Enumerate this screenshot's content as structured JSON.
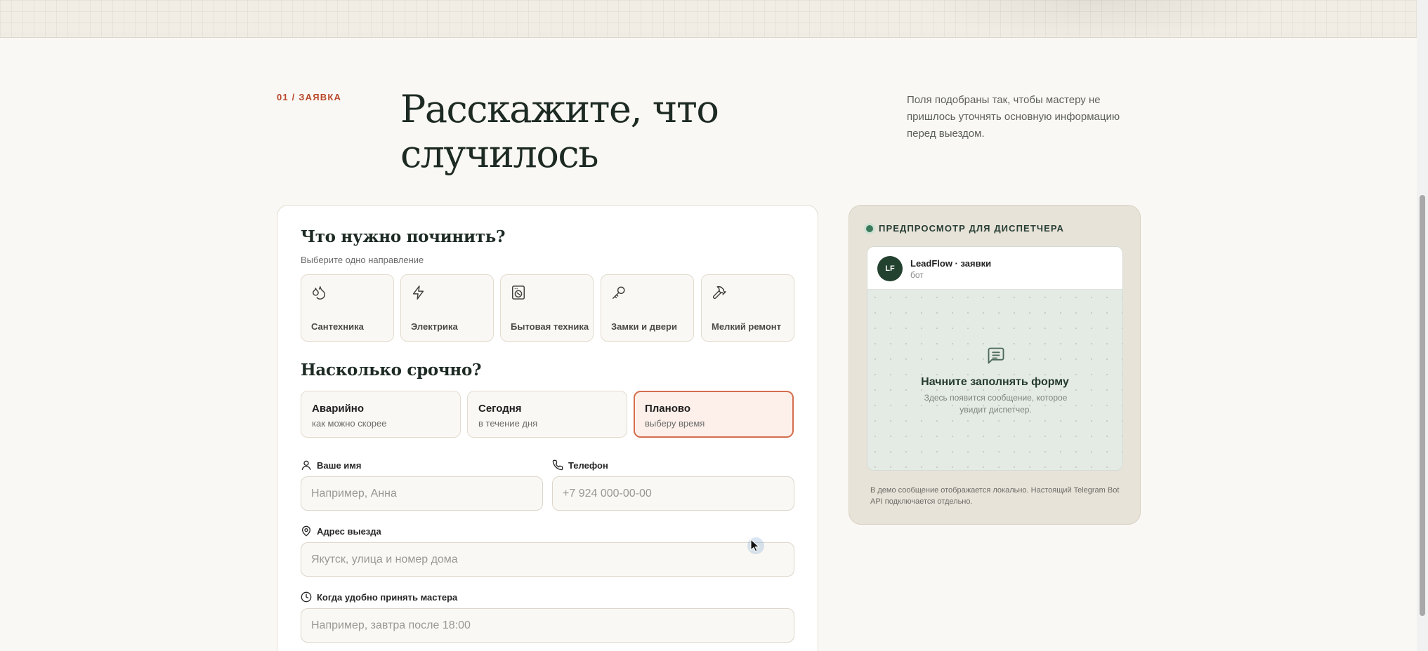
{
  "hero": {
    "eyebrow": "01 / ЗАЯВКА",
    "title_line1": "Расскажите, что",
    "title_line2": "случилось",
    "note": "Поля подобраны так, чтобы мастеру не пришлось уточнять основную информацию перед выездом."
  },
  "form": {
    "category_title": "Что нужно починить?",
    "category_subtitle": "Выберите одно направление",
    "categories": [
      {
        "label": "Сантехника",
        "icon": "droplets-icon"
      },
      {
        "label": "Электрика",
        "icon": "lightning-icon"
      },
      {
        "label": "Бытовая техника",
        "icon": "washing-machine-icon"
      },
      {
        "label": "Замки и двери",
        "icon": "key-icon"
      },
      {
        "label": "Мелкий ремонт",
        "icon": "hammer-icon"
      }
    ],
    "urgency_title": "Насколько срочно?",
    "urgency": [
      {
        "title": "Аварийно",
        "desc": "как можно скорее",
        "selected": false
      },
      {
        "title": "Сегодня",
        "desc": "в течение дня",
        "selected": false
      },
      {
        "title": "Планово",
        "desc": "выберу время",
        "selected": true
      }
    ],
    "name": {
      "label": "Ваше имя",
      "placeholder": "Например, Анна",
      "value": ""
    },
    "phone": {
      "label": "Телефон",
      "placeholder": "+7 924 000-00-00",
      "value": ""
    },
    "address": {
      "label": "Адрес выезда",
      "placeholder": "Якутск, улица и номер дома",
      "value": ""
    },
    "time": {
      "label": "Когда удобно принять мастера",
      "placeholder": "Например, завтра после 18:00",
      "value": ""
    }
  },
  "preview": {
    "heading": "ПРЕДПРОСМОТР ДЛЯ ДИСПЕТЧЕРА",
    "avatar_initials": "LF",
    "chat_name": "LeadFlow · заявки",
    "chat_sub": "бот",
    "empty_title": "Начните заполнять форму",
    "empty_sub": "Здесь появится сообщение, которое увидит диспетчер.",
    "note": "В демо сообщение отображается локально. Настоящий Telegram Bot API подключается отдельно."
  },
  "colors": {
    "accent": "#b9472a",
    "selected_border": "#d56e4f",
    "dark_green": "#23412f",
    "page_bg": "#faf8f4"
  }
}
